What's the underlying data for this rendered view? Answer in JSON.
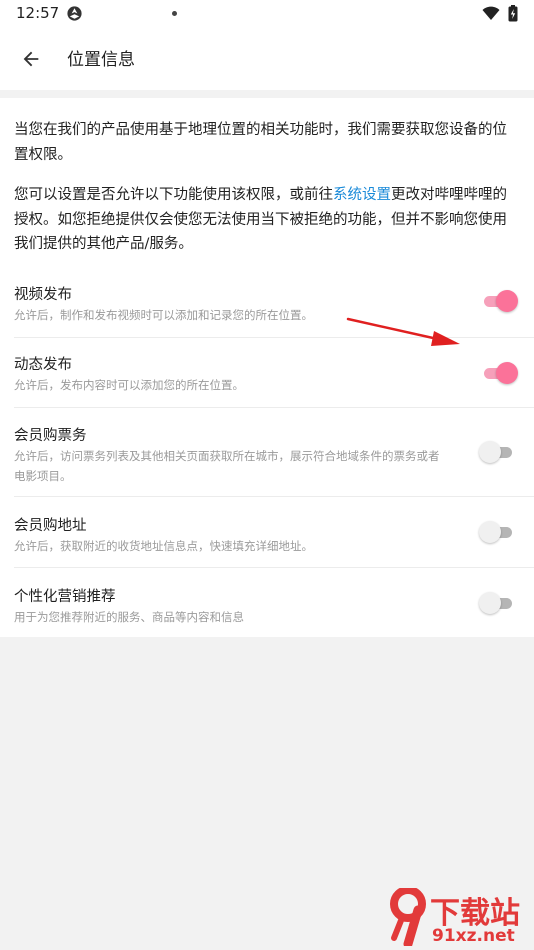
{
  "status_bar": {
    "time": "12:57",
    "app_icon": "spinner-app-icon",
    "wifi_icon": "wifi-icon",
    "battery_icon": "battery-charging-icon"
  },
  "header": {
    "back_icon": "arrow-left-icon",
    "title": "位置信息"
  },
  "intro": {
    "paragraph1": "当您在我们的产品使用基于地理位置的相关功能时，我们需要获取您设备的位置权限。",
    "paragraph2_before": "您可以设置是否允许以下功能使用该权限，或前往",
    "paragraph2_link": "系统设置",
    "paragraph2_after": "更改对哔哩哔哩的授权。如您拒绝提供仅会使您无法使用当下被拒绝的功能，但并不影响您使用我们提供的其他产品/服务。"
  },
  "settings": [
    {
      "title": "视频发布",
      "description": "允许后，制作和发布视频时可以添加和记录您的所在位置。",
      "enabled": true
    },
    {
      "title": "动态发布",
      "description": "允许后，发布内容时可以添加您的所在位置。",
      "enabled": true
    },
    {
      "title": "会员购票务",
      "description": "允许后，访问票务列表及其他相关页面获取所在城市，展示符合地域条件的票务或者电影项目。",
      "enabled": false
    },
    {
      "title": "会员购地址",
      "description": "允许后，获取附近的收货地址信息点，快速填充详细地址。",
      "enabled": false
    },
    {
      "title": "个性化营销推荐",
      "description": "用于为您推荐附近的服务、商品等内容和信息",
      "enabled": false
    }
  ],
  "colors": {
    "accent": "#fb7299",
    "link": "#1a8ad8",
    "annotation_arrow": "#e02020"
  },
  "watermark": {
    "line1": "下载站",
    "line2": "91xz.net"
  }
}
